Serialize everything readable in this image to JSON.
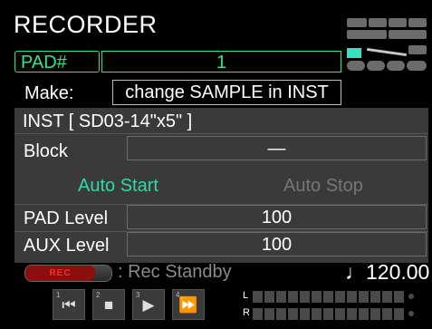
{
  "screen": {
    "title": "RECORDER"
  },
  "pad": {
    "label": "PAD#",
    "value": "1"
  },
  "make": {
    "label": "Make:",
    "value": "change SAMPLE in INST"
  },
  "inst": {
    "name": "INST [ SD03-14\"x5\" ]"
  },
  "block": {
    "label": "Block",
    "value": "—"
  },
  "auto": {
    "start": "Auto Start",
    "stop": "Auto Stop",
    "start_color": "#2fd9a8",
    "stop_color": "#767676"
  },
  "pad_level": {
    "label": "PAD Level",
    "value": "100"
  },
  "aux_level": {
    "label": "AUX Level",
    "value": "100"
  },
  "rec": {
    "button": "REC",
    "status": ": Rec Standby"
  },
  "tempo": {
    "value": "♩120.00"
  },
  "transport": [
    {
      "name": "rewind",
      "num": "1",
      "glyph": "⏮"
    },
    {
      "name": "stop",
      "num": "2",
      "glyph": "■"
    },
    {
      "name": "play",
      "num": "3",
      "glyph": "▶"
    },
    {
      "name": "fast-forward",
      "num": "4",
      "glyph": "⏩"
    }
  ],
  "meters": {
    "left_label": "L",
    "right_label": "R"
  },
  "colors": {
    "accent_green": "#2ee58a",
    "teal": "#37e0c0",
    "rec_red": "#ff2a2a"
  }
}
